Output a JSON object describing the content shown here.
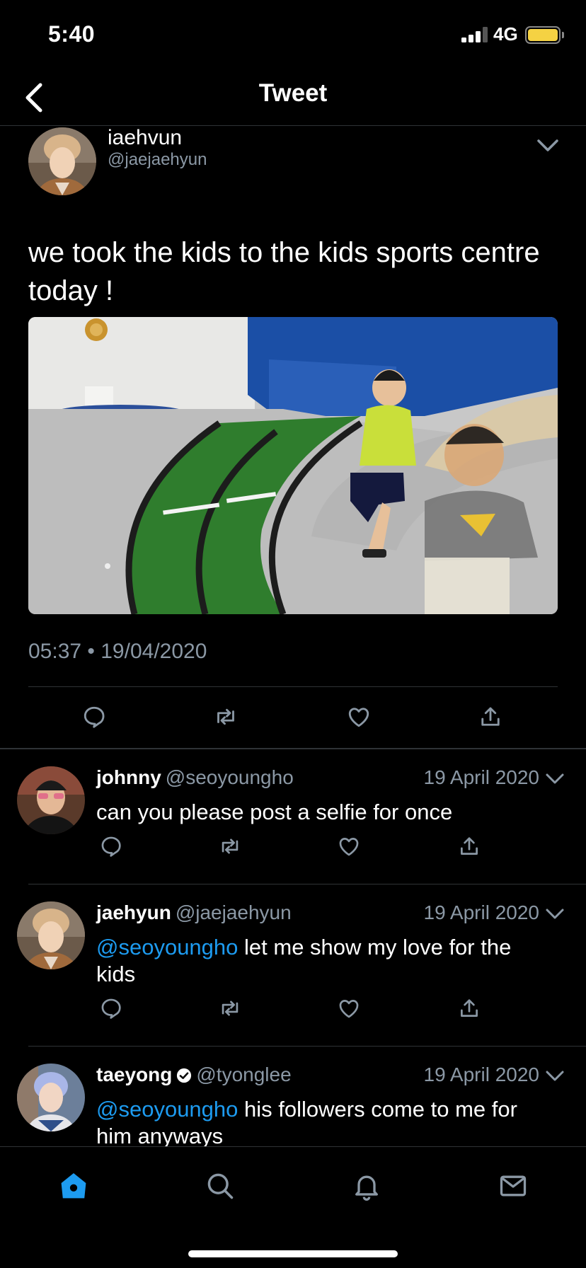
{
  "status_bar": {
    "time": "5:40",
    "network": "4G"
  },
  "nav": {
    "title": "Tweet"
  },
  "main_tweet": {
    "author_name": "iaehvun",
    "author_handle": "@jaejaehyun",
    "text": "we took the kids to the kids sports centre today !",
    "timestamp": "05:37 • 19/04/2020"
  },
  "replies": [
    {
      "name": "johnny",
      "handle": "@seoyoungho",
      "date": "19 April 2020",
      "mention": "",
      "text": "can you please post a selfie for once",
      "verified": false
    },
    {
      "name": "jaehyun",
      "handle": "@jaejaehyun",
      "date": "19 April 2020",
      "mention": "@seoyoungho",
      "text": " let me show my love for the kids",
      "verified": false
    },
    {
      "name": "taeyong",
      "handle": "@tyonglee",
      "date": "19 April 2020",
      "mention": "@seoyoungho",
      "text": " his followers come to me for him anyways",
      "verified": true
    }
  ],
  "colors": {
    "accent": "#1d9bf0",
    "muted": "#8b98a5",
    "battery": "#f5d243",
    "background": "#000000"
  },
  "tabbar": {
    "items": [
      "home-icon",
      "search-icon",
      "bell-icon",
      "mail-icon"
    ],
    "active": "home-icon"
  }
}
